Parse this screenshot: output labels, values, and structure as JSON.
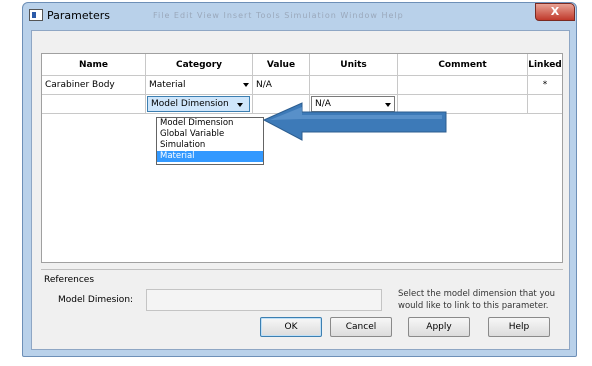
{
  "window": {
    "title": "Parameters",
    "background_menu": "File  Edit  View  Insert  Tools  Simulation  Window  Help",
    "close_glyph": "X"
  },
  "grid": {
    "columns": [
      "Name",
      "Category",
      "Value",
      "Units",
      "Comment",
      "Linked"
    ],
    "rows": [
      {
        "name": "Carabiner Body",
        "category": "Material",
        "value": "N/A",
        "units": "",
        "comment": "",
        "linked": "*"
      },
      {
        "name": "",
        "category": "Model Dimension",
        "value": "",
        "units": "N/A",
        "comment": "",
        "linked": ""
      }
    ]
  },
  "dropdown": {
    "options": [
      "Model Dimension",
      "Global Variable",
      "Simulation",
      "Material"
    ],
    "selected": "Material"
  },
  "references": {
    "title": "References",
    "model_dimension_label": "Model Dimesion:",
    "hint": "Select the model dimension that you would like to link to this parameter."
  },
  "buttons": {
    "ok": "OK",
    "cancel": "Cancel",
    "apply": "Apply",
    "help": "Help"
  },
  "colors": {
    "selection": "#3399ff",
    "arrow": "#3d7ab8",
    "titlebar": "#b9d1ea",
    "close": "#c0392b"
  }
}
